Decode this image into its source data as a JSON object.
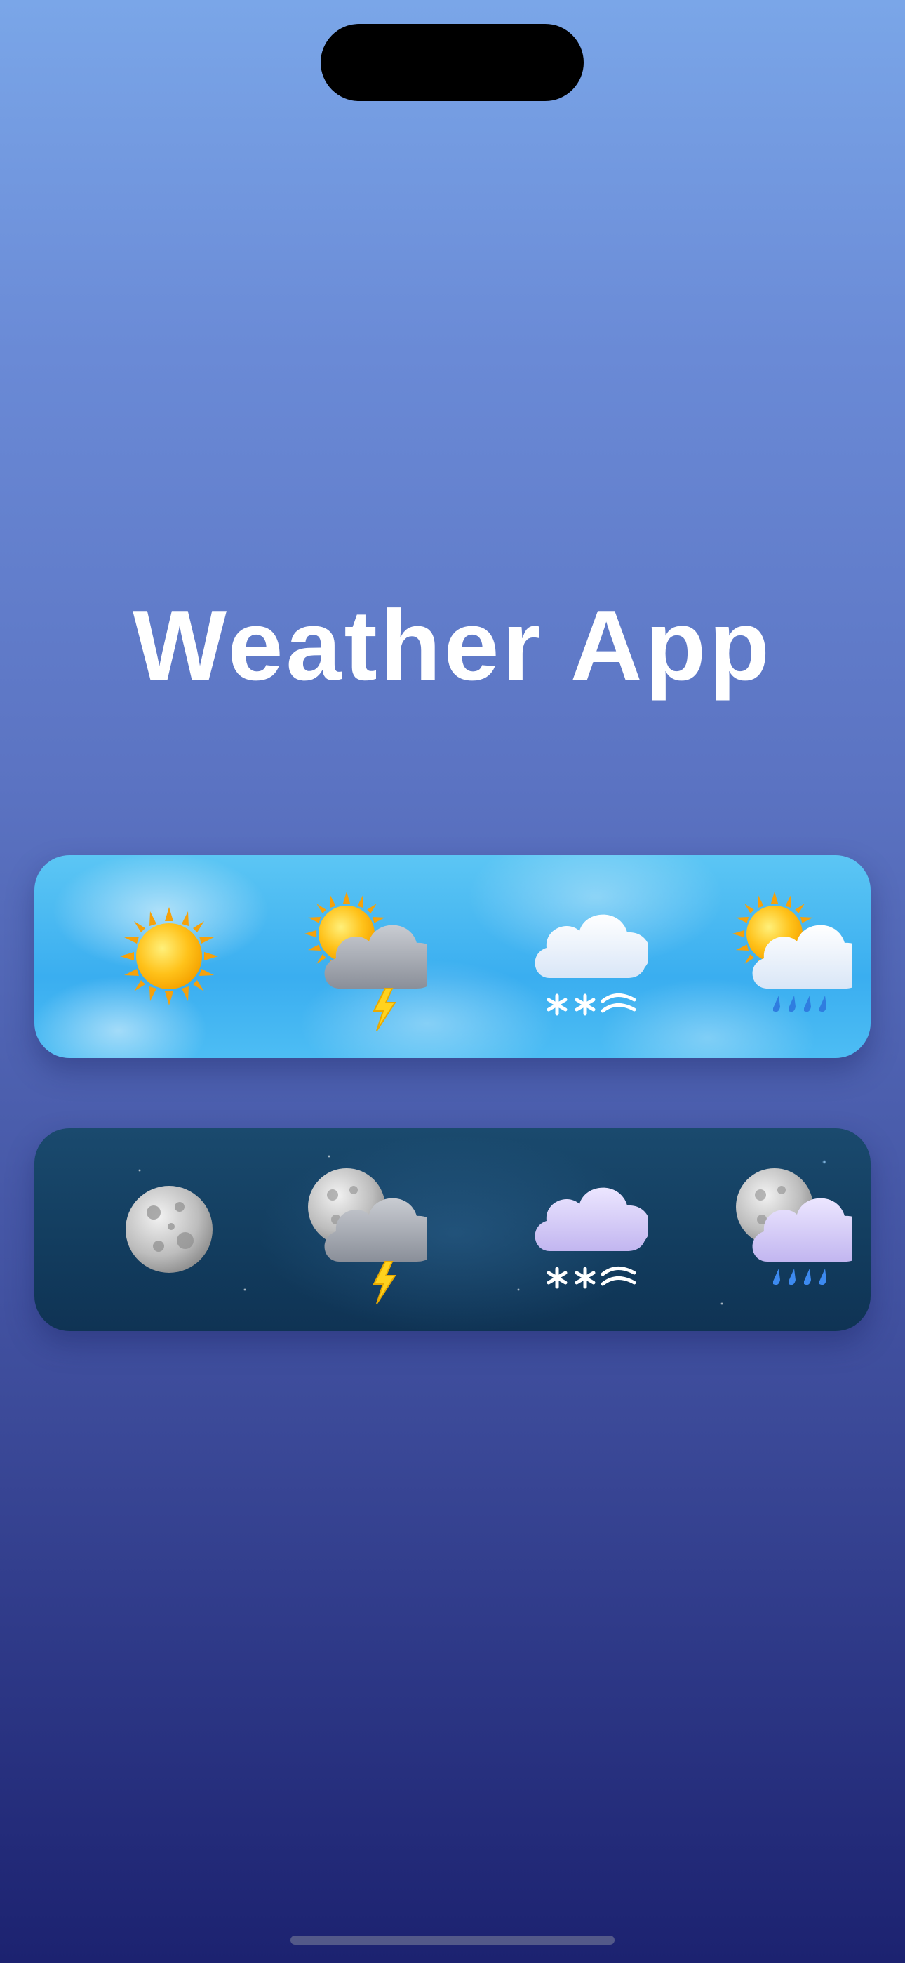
{
  "app": {
    "title": "Weather App"
  },
  "rows": [
    {
      "name": "day",
      "icons": [
        "sun-icon",
        "sun-cloud-lightning-icon",
        "cloud-snow-wind-icon",
        "sun-cloud-rain-icon"
      ]
    },
    {
      "name": "night",
      "icons": [
        "moon-icon",
        "moon-cloud-lightning-icon",
        "cloud-snow-wind-icon",
        "moon-cloud-rain-icon"
      ]
    }
  ],
  "colors": {
    "background_top": "#7aa6e8",
    "background_bottom": "#1c2270",
    "day_card": "#3aaef0",
    "night_card": "#123c5e",
    "title": "#ffffff"
  }
}
